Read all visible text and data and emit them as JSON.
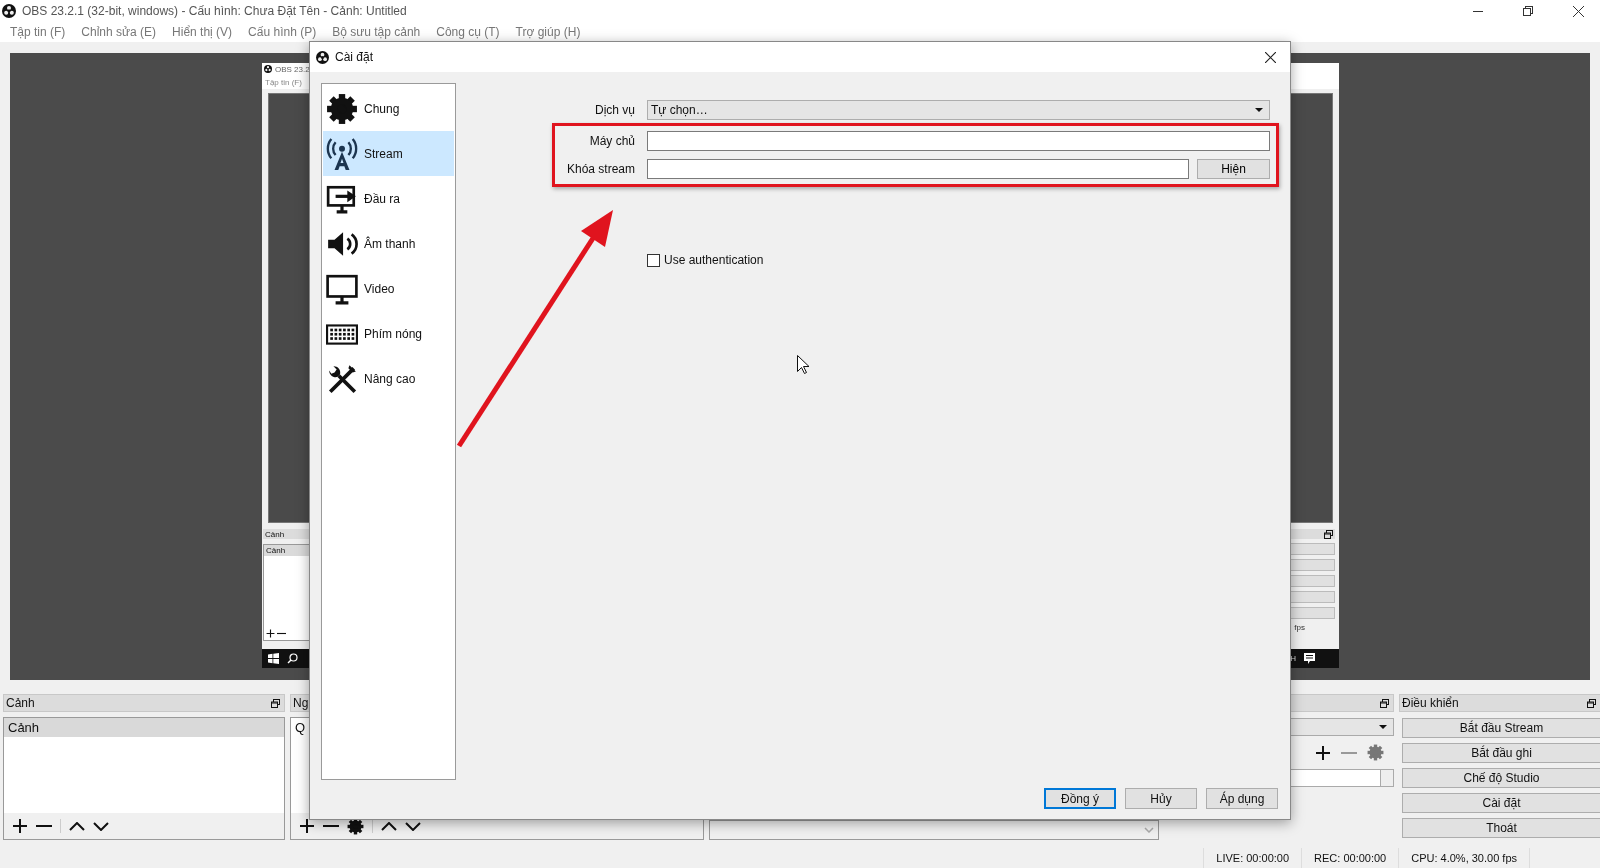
{
  "window": {
    "title": "OBS 23.2.1 (32-bit, windows) - Cấu hình: Chưa Đặt Tên - Cảnh: Untitled"
  },
  "menu": [
    "Tập tin (F)",
    "Chỉnh sửa (E)",
    "Hiển thị (V)",
    "Cấu hình (P)",
    "Bộ sưu tập cảnh",
    "Công cụ (T)",
    "Trợ giúp (H)"
  ],
  "preview_screenshot": {
    "title": "OBS 23.2",
    "menu": "Tập tin (F)",
    "dock_title": "Cảnh",
    "scene_item": "Cảnh",
    "status": "fps",
    "tray_text": "H"
  },
  "docks": {
    "scenes": {
      "title": "Cảnh",
      "items": [
        {
          "label": "Cảnh",
          "selected": true
        }
      ]
    },
    "sources": {
      "title": "Ng",
      "first_item": "Q"
    },
    "controls": {
      "title": "Điều khiển",
      "buttons": [
        "Bắt đầu Stream",
        "Bắt đầu ghi",
        "Chế độ Studio",
        "Cài đặt",
        "Thoát"
      ]
    }
  },
  "status_bar": [
    "LIVE: 00:00:00",
    "REC: 00:00:00",
    "CPU: 4.0%, 30.00 fps"
  ],
  "dialog": {
    "title": "Cài đặt",
    "categories": [
      {
        "kind": "general",
        "label": "Chung",
        "selected": false
      },
      {
        "kind": "stream",
        "label": "Stream",
        "selected": true
      },
      {
        "kind": "output",
        "label": "Đầu ra",
        "selected": false
      },
      {
        "kind": "audio",
        "label": "Âm thanh",
        "selected": false
      },
      {
        "kind": "video",
        "label": "Video",
        "selected": false
      },
      {
        "kind": "hotkeys",
        "label": "Phím nóng",
        "selected": false
      },
      {
        "kind": "advanced",
        "label": "Nâng cao",
        "selected": false
      }
    ],
    "service": {
      "label": "Dịch vụ",
      "value": "Tự chọn…"
    },
    "server": {
      "label": "Máy chủ"
    },
    "stream_key": {
      "label": "Khóa stream",
      "button": "Hiện"
    },
    "use_auth": {
      "label": "Use authentication",
      "checked": false
    },
    "buttons": [
      {
        "label": "Đồng ý",
        "default": true
      },
      {
        "label": "Hủy",
        "default": false
      },
      {
        "label": "Áp dụng",
        "default": false
      }
    ]
  }
}
